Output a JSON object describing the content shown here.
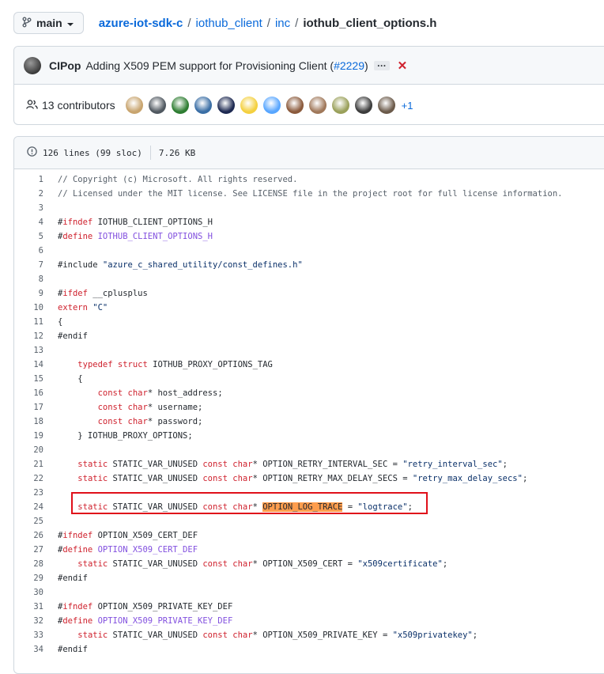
{
  "branch": {
    "name": "main"
  },
  "breadcrumb": {
    "repo": "azure-iot-sdk-c",
    "dir1": "iothub_client",
    "dir2": "inc",
    "file": "iothub_client_options.h",
    "sep": "/"
  },
  "commit": {
    "author": "CIPop",
    "message_prefix": "Adding X509 PEM support for Provisioning Client (",
    "pr": "#2229",
    "message_suffix": ")",
    "ellipsis": "…",
    "status": "✕"
  },
  "contributors": {
    "label": "13 contributors",
    "more": "+1",
    "avatar_colors": [
      "#c8a46e",
      "#505860",
      "#2e7d32",
      "#3a6ea5",
      "#1e2a52",
      "#f4d03f",
      "#58a6ff",
      "#8b5a3c",
      "#a0785a",
      "#9aa05a",
      "#3c3c3c",
      "#6b5a4a"
    ]
  },
  "file_info": {
    "lines": "126 lines (99 sloc)",
    "size": "7.26 KB"
  },
  "colors": {
    "link": "#0969da",
    "highlight": "#ff9d4d",
    "annotation": "#e0101a"
  },
  "code_lines": [
    {
      "n": "1",
      "tokens": [
        {
          "t": "// Copyright (c) Microsoft. All rights reserved.",
          "c": "cmt"
        }
      ]
    },
    {
      "n": "2",
      "tokens": [
        {
          "t": "// Licensed under the MIT license. See LICENSE file in the project root for full license information.",
          "c": "cmt"
        }
      ]
    },
    {
      "n": "3",
      "tokens": []
    },
    {
      "n": "4",
      "tokens": [
        {
          "t": "#",
          "c": ""
        },
        {
          "t": "ifndef",
          "c": "kw"
        },
        {
          "t": " IOTHUB_CLIENT_OPTIONS_H",
          "c": ""
        }
      ]
    },
    {
      "n": "5",
      "tokens": [
        {
          "t": "#",
          "c": ""
        },
        {
          "t": "define",
          "c": "kw"
        },
        {
          "t": " ",
          "c": ""
        },
        {
          "t": "IOTHUB_CLIENT_OPTIONS_H",
          "c": "mac"
        }
      ]
    },
    {
      "n": "6",
      "tokens": []
    },
    {
      "n": "7",
      "tokens": [
        {
          "t": "#include ",
          "c": ""
        },
        {
          "t": "\"azure_c_shared_utility/const_defines.h\"",
          "c": "str"
        }
      ]
    },
    {
      "n": "8",
      "tokens": []
    },
    {
      "n": "9",
      "tokens": [
        {
          "t": "#",
          "c": ""
        },
        {
          "t": "ifdef",
          "c": "kw"
        },
        {
          "t": " __cplusplus",
          "c": ""
        }
      ]
    },
    {
      "n": "10",
      "tokens": [
        {
          "t": "extern",
          "c": "kw"
        },
        {
          "t": " ",
          "c": ""
        },
        {
          "t": "\"C\"",
          "c": "str"
        }
      ]
    },
    {
      "n": "11",
      "tokens": [
        {
          "t": "{",
          "c": ""
        }
      ]
    },
    {
      "n": "12",
      "tokens": [
        {
          "t": "#endif",
          "c": ""
        }
      ]
    },
    {
      "n": "13",
      "tokens": []
    },
    {
      "n": "14",
      "tokens": [
        {
          "t": "    ",
          "c": ""
        },
        {
          "t": "typedef",
          "c": "kw"
        },
        {
          "t": " ",
          "c": ""
        },
        {
          "t": "struct",
          "c": "kw"
        },
        {
          "t": " IOTHUB_PROXY_OPTIONS_TAG",
          "c": ""
        }
      ]
    },
    {
      "n": "15",
      "tokens": [
        {
          "t": "    {",
          "c": ""
        }
      ]
    },
    {
      "n": "16",
      "tokens": [
        {
          "t": "        ",
          "c": ""
        },
        {
          "t": "const",
          "c": "kw"
        },
        {
          "t": " ",
          "c": ""
        },
        {
          "t": "char",
          "c": "kw"
        },
        {
          "t": "* host_address;",
          "c": ""
        }
      ]
    },
    {
      "n": "17",
      "tokens": [
        {
          "t": "        ",
          "c": ""
        },
        {
          "t": "const",
          "c": "kw"
        },
        {
          "t": " ",
          "c": ""
        },
        {
          "t": "char",
          "c": "kw"
        },
        {
          "t": "* username;",
          "c": ""
        }
      ]
    },
    {
      "n": "18",
      "tokens": [
        {
          "t": "        ",
          "c": ""
        },
        {
          "t": "const",
          "c": "kw"
        },
        {
          "t": " ",
          "c": ""
        },
        {
          "t": "char",
          "c": "kw"
        },
        {
          "t": "* password;",
          "c": ""
        }
      ]
    },
    {
      "n": "19",
      "tokens": [
        {
          "t": "    } IOTHUB_PROXY_OPTIONS;",
          "c": ""
        }
      ]
    },
    {
      "n": "20",
      "tokens": []
    },
    {
      "n": "21",
      "tokens": [
        {
          "t": "    ",
          "c": ""
        },
        {
          "t": "static",
          "c": "kw"
        },
        {
          "t": " STATIC_VAR_UNUSED ",
          "c": ""
        },
        {
          "t": "const",
          "c": "kw"
        },
        {
          "t": " ",
          "c": ""
        },
        {
          "t": "char",
          "c": "kw"
        },
        {
          "t": "* OPTION_RETRY_INTERVAL_SEC = ",
          "c": ""
        },
        {
          "t": "\"retry_interval_sec\"",
          "c": "str"
        },
        {
          "t": ";",
          "c": ""
        }
      ]
    },
    {
      "n": "22",
      "tokens": [
        {
          "t": "    ",
          "c": ""
        },
        {
          "t": "static",
          "c": "kw"
        },
        {
          "t": " STATIC_VAR_UNUSED ",
          "c": ""
        },
        {
          "t": "const",
          "c": "kw"
        },
        {
          "t": " ",
          "c": ""
        },
        {
          "t": "char",
          "c": "kw"
        },
        {
          "t": "* OPTION_RETRY_MAX_DELAY_SECS = ",
          "c": ""
        },
        {
          "t": "\"retry_max_delay_secs\"",
          "c": "str"
        },
        {
          "t": ";",
          "c": ""
        }
      ]
    },
    {
      "n": "23",
      "tokens": []
    },
    {
      "n": "24",
      "tokens": [
        {
          "t": "    ",
          "c": ""
        },
        {
          "t": "static",
          "c": "kw"
        },
        {
          "t": " STATIC_VAR_UNUSED ",
          "c": ""
        },
        {
          "t": "const",
          "c": "kw"
        },
        {
          "t": " ",
          "c": ""
        },
        {
          "t": "char",
          "c": "kw"
        },
        {
          "t": "* ",
          "c": ""
        },
        {
          "t": "OPTION_LOG_TRACE",
          "c": "hl"
        },
        {
          "t": " = ",
          "c": ""
        },
        {
          "t": "\"logtrace\"",
          "c": "str"
        },
        {
          "t": ";",
          "c": ""
        }
      ]
    },
    {
      "n": "25",
      "tokens": []
    },
    {
      "n": "26",
      "tokens": [
        {
          "t": "#",
          "c": ""
        },
        {
          "t": "ifndef",
          "c": "kw"
        },
        {
          "t": " OPTION_X509_CERT_DEF",
          "c": ""
        }
      ]
    },
    {
      "n": "27",
      "tokens": [
        {
          "t": "#",
          "c": ""
        },
        {
          "t": "define",
          "c": "kw"
        },
        {
          "t": " ",
          "c": ""
        },
        {
          "t": "OPTION_X509_CERT_DEF",
          "c": "mac"
        }
      ]
    },
    {
      "n": "28",
      "tokens": [
        {
          "t": "    ",
          "c": ""
        },
        {
          "t": "static",
          "c": "kw"
        },
        {
          "t": " STATIC_VAR_UNUSED ",
          "c": ""
        },
        {
          "t": "const",
          "c": "kw"
        },
        {
          "t": " ",
          "c": ""
        },
        {
          "t": "char",
          "c": "kw"
        },
        {
          "t": "* OPTION_X509_CERT = ",
          "c": ""
        },
        {
          "t": "\"x509certificate\"",
          "c": "str"
        },
        {
          "t": ";",
          "c": ""
        }
      ]
    },
    {
      "n": "29",
      "tokens": [
        {
          "t": "#endif",
          "c": ""
        }
      ]
    },
    {
      "n": "30",
      "tokens": []
    },
    {
      "n": "31",
      "tokens": [
        {
          "t": "#",
          "c": ""
        },
        {
          "t": "ifndef",
          "c": "kw"
        },
        {
          "t": " OPTION_X509_PRIVATE_KEY_DEF",
          "c": ""
        }
      ]
    },
    {
      "n": "32",
      "tokens": [
        {
          "t": "#",
          "c": ""
        },
        {
          "t": "define",
          "c": "kw"
        },
        {
          "t": " ",
          "c": ""
        },
        {
          "t": "OPTION_X509_PRIVATE_KEY_DEF",
          "c": "mac"
        }
      ]
    },
    {
      "n": "33",
      "tokens": [
        {
          "t": "    ",
          "c": ""
        },
        {
          "t": "static",
          "c": "kw"
        },
        {
          "t": " STATIC_VAR_UNUSED ",
          "c": ""
        },
        {
          "t": "const",
          "c": "kw"
        },
        {
          "t": " ",
          "c": ""
        },
        {
          "t": "char",
          "c": "kw"
        },
        {
          "t": "* OPTION_X509_PRIVATE_KEY = ",
          "c": ""
        },
        {
          "t": "\"x509privatekey\"",
          "c": "str"
        },
        {
          "t": ";",
          "c": ""
        }
      ]
    },
    {
      "n": "34",
      "tokens": [
        {
          "t": "#endif",
          "c": ""
        }
      ]
    }
  ]
}
